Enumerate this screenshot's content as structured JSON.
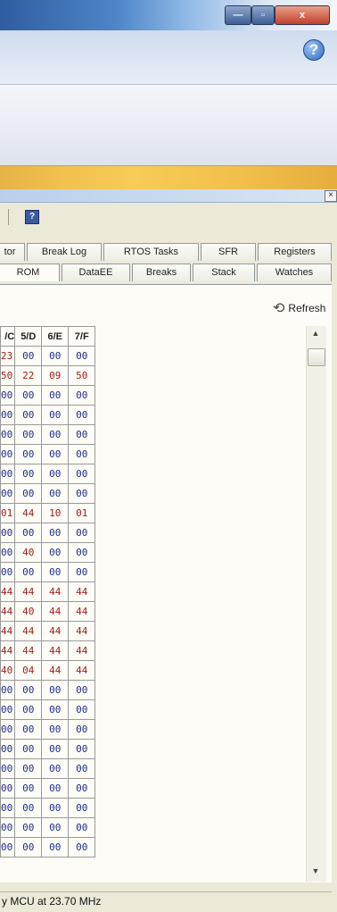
{
  "window": {
    "min_glyph": "—",
    "max_glyph": "▫",
    "close_glyph": "x",
    "help_glyph": "?"
  },
  "dock": {
    "close_glyph": "×",
    "toolbar_icon_glyph": "?"
  },
  "tabs_row1": [
    "tor",
    "Break Log",
    "RTOS Tasks",
    "SFR",
    "Registers"
  ],
  "tabs_row2": [
    "ROM",
    "DataEE",
    "Breaks",
    "Stack",
    "Watches"
  ],
  "refresh_label": "Refresh",
  "grid": {
    "headers": [
      "/C",
      "5/D",
      "6/E",
      "7/F"
    ],
    "rows": [
      {
        "c0": "23",
        "cells": [
          "00",
          "00",
          "00"
        ],
        "color": [
          "red",
          "blue",
          "blue",
          "blue"
        ]
      },
      {
        "c0": "50",
        "cells": [
          "22",
          "09",
          "50"
        ],
        "color": [
          "red",
          "red",
          "red",
          "red"
        ]
      },
      {
        "c0": "00",
        "cells": [
          "00",
          "00",
          "00"
        ],
        "color": [
          "blue",
          "blue",
          "blue",
          "blue"
        ]
      },
      {
        "c0": "00",
        "cells": [
          "00",
          "00",
          "00"
        ],
        "color": [
          "blue",
          "blue",
          "blue",
          "blue"
        ]
      },
      {
        "c0": "00",
        "cells": [
          "00",
          "00",
          "00"
        ],
        "color": [
          "blue",
          "blue",
          "blue",
          "blue"
        ]
      },
      {
        "c0": "00",
        "cells": [
          "00",
          "00",
          "00"
        ],
        "color": [
          "blue",
          "blue",
          "blue",
          "blue"
        ]
      },
      {
        "c0": "00",
        "cells": [
          "00",
          "00",
          "00"
        ],
        "color": [
          "blue",
          "blue",
          "blue",
          "blue"
        ]
      },
      {
        "c0": "00",
        "cells": [
          "00",
          "00",
          "00"
        ],
        "color": [
          "blue",
          "blue",
          "blue",
          "blue"
        ]
      },
      {
        "c0": "01",
        "cells": [
          "44",
          "10",
          "01"
        ],
        "color": [
          "red",
          "red",
          "red",
          "red"
        ]
      },
      {
        "c0": "00",
        "cells": [
          "00",
          "00",
          "00"
        ],
        "color": [
          "blue",
          "blue",
          "blue",
          "blue"
        ]
      },
      {
        "c0": "00",
        "cells": [
          "40",
          "00",
          "00"
        ],
        "color": [
          "blue",
          "red",
          "blue",
          "blue"
        ]
      },
      {
        "c0": "00",
        "cells": [
          "00",
          "00",
          "00"
        ],
        "color": [
          "blue",
          "blue",
          "blue",
          "blue"
        ]
      },
      {
        "c0": "44",
        "cells": [
          "44",
          "44",
          "44"
        ],
        "color": [
          "red",
          "red",
          "red",
          "red"
        ]
      },
      {
        "c0": "44",
        "cells": [
          "40",
          "44",
          "44"
        ],
        "color": [
          "red",
          "red",
          "red",
          "red"
        ]
      },
      {
        "c0": "44",
        "cells": [
          "44",
          "44",
          "44"
        ],
        "color": [
          "red",
          "red",
          "red",
          "red"
        ]
      },
      {
        "c0": "44",
        "cells": [
          "44",
          "44",
          "44"
        ],
        "color": [
          "red",
          "red",
          "red",
          "red"
        ]
      },
      {
        "c0": "40",
        "cells": [
          "04",
          "44",
          "44"
        ],
        "color": [
          "red",
          "red",
          "red",
          "red"
        ]
      },
      {
        "c0": "00",
        "cells": [
          "00",
          "00",
          "00"
        ],
        "color": [
          "blue",
          "blue",
          "blue",
          "blue"
        ]
      },
      {
        "c0": "00",
        "cells": [
          "00",
          "00",
          "00"
        ],
        "color": [
          "blue",
          "blue",
          "blue",
          "blue"
        ]
      },
      {
        "c0": "00",
        "cells": [
          "00",
          "00",
          "00"
        ],
        "color": [
          "blue",
          "blue",
          "blue",
          "blue"
        ]
      },
      {
        "c0": "00",
        "cells": [
          "00",
          "00",
          "00"
        ],
        "color": [
          "blue",
          "blue",
          "blue",
          "blue"
        ]
      },
      {
        "c0": "00",
        "cells": [
          "00",
          "00",
          "00"
        ],
        "color": [
          "blue",
          "blue",
          "blue",
          "blue"
        ]
      },
      {
        "c0": "00",
        "cells": [
          "00",
          "00",
          "00"
        ],
        "color": [
          "blue",
          "blue",
          "blue",
          "blue"
        ]
      },
      {
        "c0": "00",
        "cells": [
          "00",
          "00",
          "00"
        ],
        "color": [
          "blue",
          "blue",
          "blue",
          "blue"
        ]
      },
      {
        "c0": "00",
        "cells": [
          "00",
          "00",
          "00"
        ],
        "color": [
          "blue",
          "blue",
          "blue",
          "blue"
        ]
      },
      {
        "c0": "00",
        "cells": [
          "00",
          "00",
          "00"
        ],
        "color": [
          "blue",
          "blue",
          "blue",
          "blue"
        ]
      }
    ]
  },
  "scroll": {
    "up": "▲",
    "down": "▼"
  },
  "status_text": "y MCU at 23.70 MHz",
  "colors": {
    "value_blue": "#1f2e8e",
    "value_red": "#a01c1c"
  }
}
